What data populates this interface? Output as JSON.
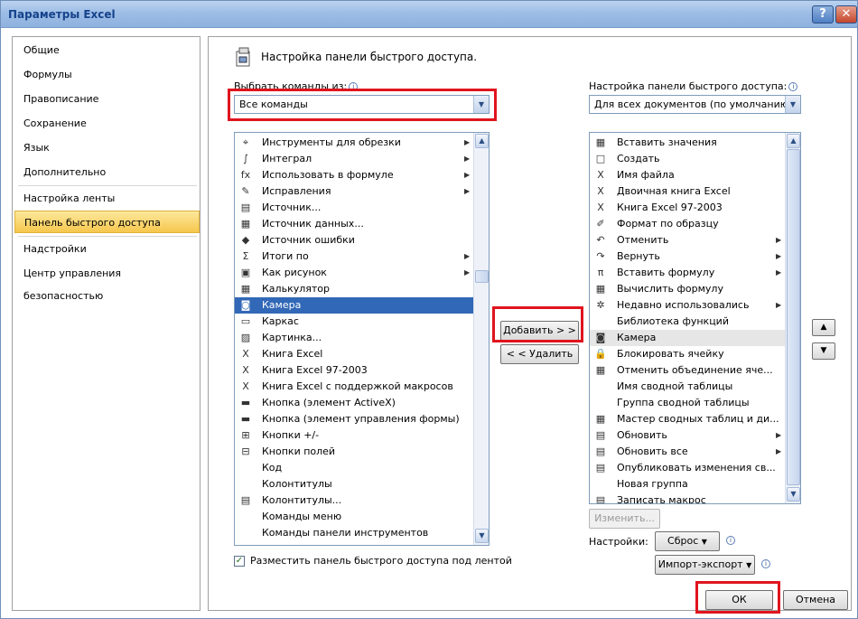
{
  "window": {
    "title": "Параметры Excel",
    "help": "?",
    "close": "✕"
  },
  "nav": {
    "items": [
      {
        "label": "Общие"
      },
      {
        "label": "Формулы"
      },
      {
        "label": "Правописание"
      },
      {
        "label": "Сохранение"
      },
      {
        "label": "Язык"
      },
      {
        "label": "Дополнительно"
      },
      {
        "label": "Настройка ленты"
      },
      {
        "label": "Панель быстрого доступа"
      },
      {
        "label": "Надстройки"
      },
      {
        "label": "Центр управления безопасностью"
      }
    ]
  },
  "main": {
    "heading": "Настройка панели быстрого доступа.",
    "choose_label": "Выбрать команды из:",
    "choose_value": "Все команды",
    "qat_label": "Настройка панели быстрого доступа:",
    "qat_value": "Для всех документов (по умолчанию)",
    "commands": [
      {
        "icon": "⌖",
        "label": "Инструменты для обрезки",
        "sub": true
      },
      {
        "icon": "∫",
        "label": "Интеграл",
        "sub": true
      },
      {
        "icon": "fx",
        "label": "Использовать в формуле",
        "sub": true
      },
      {
        "icon": "✎",
        "label": "Исправления",
        "sub": true
      },
      {
        "icon": "▤",
        "label": "Источник...",
        "sub": false
      },
      {
        "icon": "▦",
        "label": "Источник данных...",
        "sub": false
      },
      {
        "icon": "◆",
        "label": "Источник ошибки",
        "sub": false
      },
      {
        "icon": "Σ",
        "label": "Итоги по",
        "sub": true
      },
      {
        "icon": "▣",
        "label": "Как рисунок",
        "sub": true
      },
      {
        "icon": "▦",
        "label": "Калькулятор",
        "sub": false
      },
      {
        "icon": "◙",
        "label": "Камера",
        "sub": false
      },
      {
        "icon": "▭",
        "label": "Каркас",
        "sub": false
      },
      {
        "icon": "▨",
        "label": "Картинка...",
        "sub": false
      },
      {
        "icon": "X",
        "label": "Книга Excel",
        "sub": false
      },
      {
        "icon": "X",
        "label": "Книга Excel 97-2003",
        "sub": false
      },
      {
        "icon": "X",
        "label": "Книга Excel с поддержкой макросов",
        "sub": false
      },
      {
        "icon": "▬",
        "label": "Кнопка (элемент ActiveX)",
        "sub": false
      },
      {
        "icon": "▬",
        "label": "Кнопка (элемент управления формы)",
        "sub": false
      },
      {
        "icon": "⊞",
        "label": "Кнопки +/-",
        "sub": false
      },
      {
        "icon": "⊟",
        "label": "Кнопки полей",
        "sub": false
      },
      {
        "icon": "",
        "label": "Код",
        "sub": false
      },
      {
        "icon": "",
        "label": "Колонтитулы",
        "sub": false
      },
      {
        "icon": "▤",
        "label": "Колонтитулы...",
        "sub": false
      },
      {
        "icon": "",
        "label": "Команды меню",
        "sub": false
      },
      {
        "icon": "",
        "label": "Команды панели инструментов",
        "sub": false
      }
    ],
    "qat_items": [
      {
        "icon": "▦",
        "label": "Вставить значения",
        "sub": false
      },
      {
        "icon": "□",
        "label": "Создать",
        "sub": false
      },
      {
        "icon": "X",
        "label": "Имя файла",
        "sub": false
      },
      {
        "icon": "X",
        "label": "Двоичная книга Excel",
        "sub": false
      },
      {
        "icon": "X",
        "label": "Книга Excel 97-2003",
        "sub": false
      },
      {
        "icon": "✐",
        "label": "Формат по образцу",
        "sub": false
      },
      {
        "icon": "↶",
        "label": "Отменить",
        "sub": true
      },
      {
        "icon": "↷",
        "label": "Вернуть",
        "sub": true
      },
      {
        "icon": "π",
        "label": "Вставить формулу",
        "sub": true
      },
      {
        "icon": "▦",
        "label": "Вычислить формулу",
        "sub": false
      },
      {
        "icon": "✲",
        "label": "Недавно использовались",
        "sub": true
      },
      {
        "icon": "",
        "label": "Библиотека функций",
        "sub": false
      },
      {
        "icon": "◙",
        "label": "Камера",
        "sub": false
      },
      {
        "icon": "🔒",
        "label": "Блокировать ячейку",
        "sub": false
      },
      {
        "icon": "▦",
        "label": "Отменить объединение яче...",
        "sub": false
      },
      {
        "icon": "",
        "label": "Имя сводной таблицы",
        "sub": false
      },
      {
        "icon": "",
        "label": "Группа сводной таблицы",
        "sub": false
      },
      {
        "icon": "▦",
        "label": "Мастер сводных таблиц и ди...",
        "sub": false
      },
      {
        "icon": "▤",
        "label": "Обновить",
        "sub": true
      },
      {
        "icon": "▤",
        "label": "Обновить все",
        "sub": true
      },
      {
        "icon": "▤",
        "label": "Опубликовать изменения св...",
        "sub": false
      },
      {
        "icon": "",
        "label": "Новая группа",
        "sub": false
      },
      {
        "icon": "▤",
        "label": "Записать макрос",
        "sub": false
      }
    ],
    "add_button": "Добавить > >",
    "remove_button": "< < Удалить",
    "modify_button": "Изменить...",
    "show_below_label": "Разместить панель быстрого доступа под лентой",
    "settings_label": "Настройки:",
    "reset_button": "Сброс",
    "import_export_button": "Импорт-экспорт"
  },
  "footer": {
    "ok": "ОК",
    "cancel": "Отмена"
  },
  "colors": {
    "selection": "#3168b7",
    "highlight_frame": "#e0141e",
    "active_nav": "#f6c74d"
  }
}
